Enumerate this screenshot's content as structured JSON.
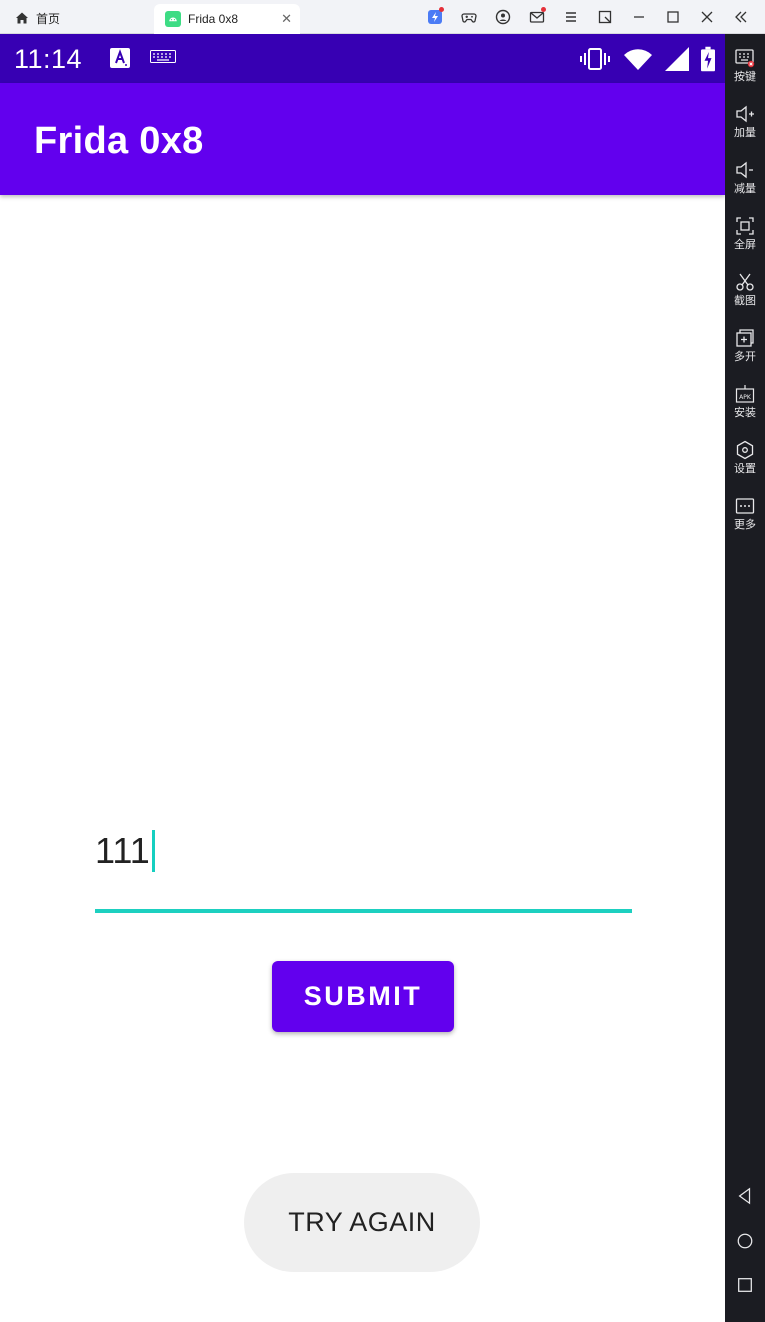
{
  "emulator": {
    "home_tab_label": "首页",
    "app_tab_label": "Frida 0x8",
    "sidebar": [
      {
        "icon": "keyboard-icon",
        "label": "按键"
      },
      {
        "icon": "volume-up-icon",
        "label": "加量"
      },
      {
        "icon": "volume-down-icon",
        "label": "减量"
      },
      {
        "icon": "fullscreen-icon",
        "label": "全屏"
      },
      {
        "icon": "scissors-icon",
        "label": "截图"
      },
      {
        "icon": "multi-instance-icon",
        "label": "多开"
      },
      {
        "icon": "apk-icon",
        "label": "安装"
      },
      {
        "icon": "settings-hex-icon",
        "label": "设置"
      },
      {
        "icon": "more-icon",
        "label": "更多"
      }
    ]
  },
  "status_bar": {
    "time": "11:14"
  },
  "app_bar": {
    "title": "Frida 0x8"
  },
  "main": {
    "input_value": "111",
    "submit_label": "SUBMIT",
    "try_again_label": "TRY AGAIN"
  },
  "colors": {
    "status_bar": "#3700b3",
    "app_bar": "#6200ee",
    "accent": "#1dd0c0",
    "emulator_dark": "#1b1c22"
  }
}
